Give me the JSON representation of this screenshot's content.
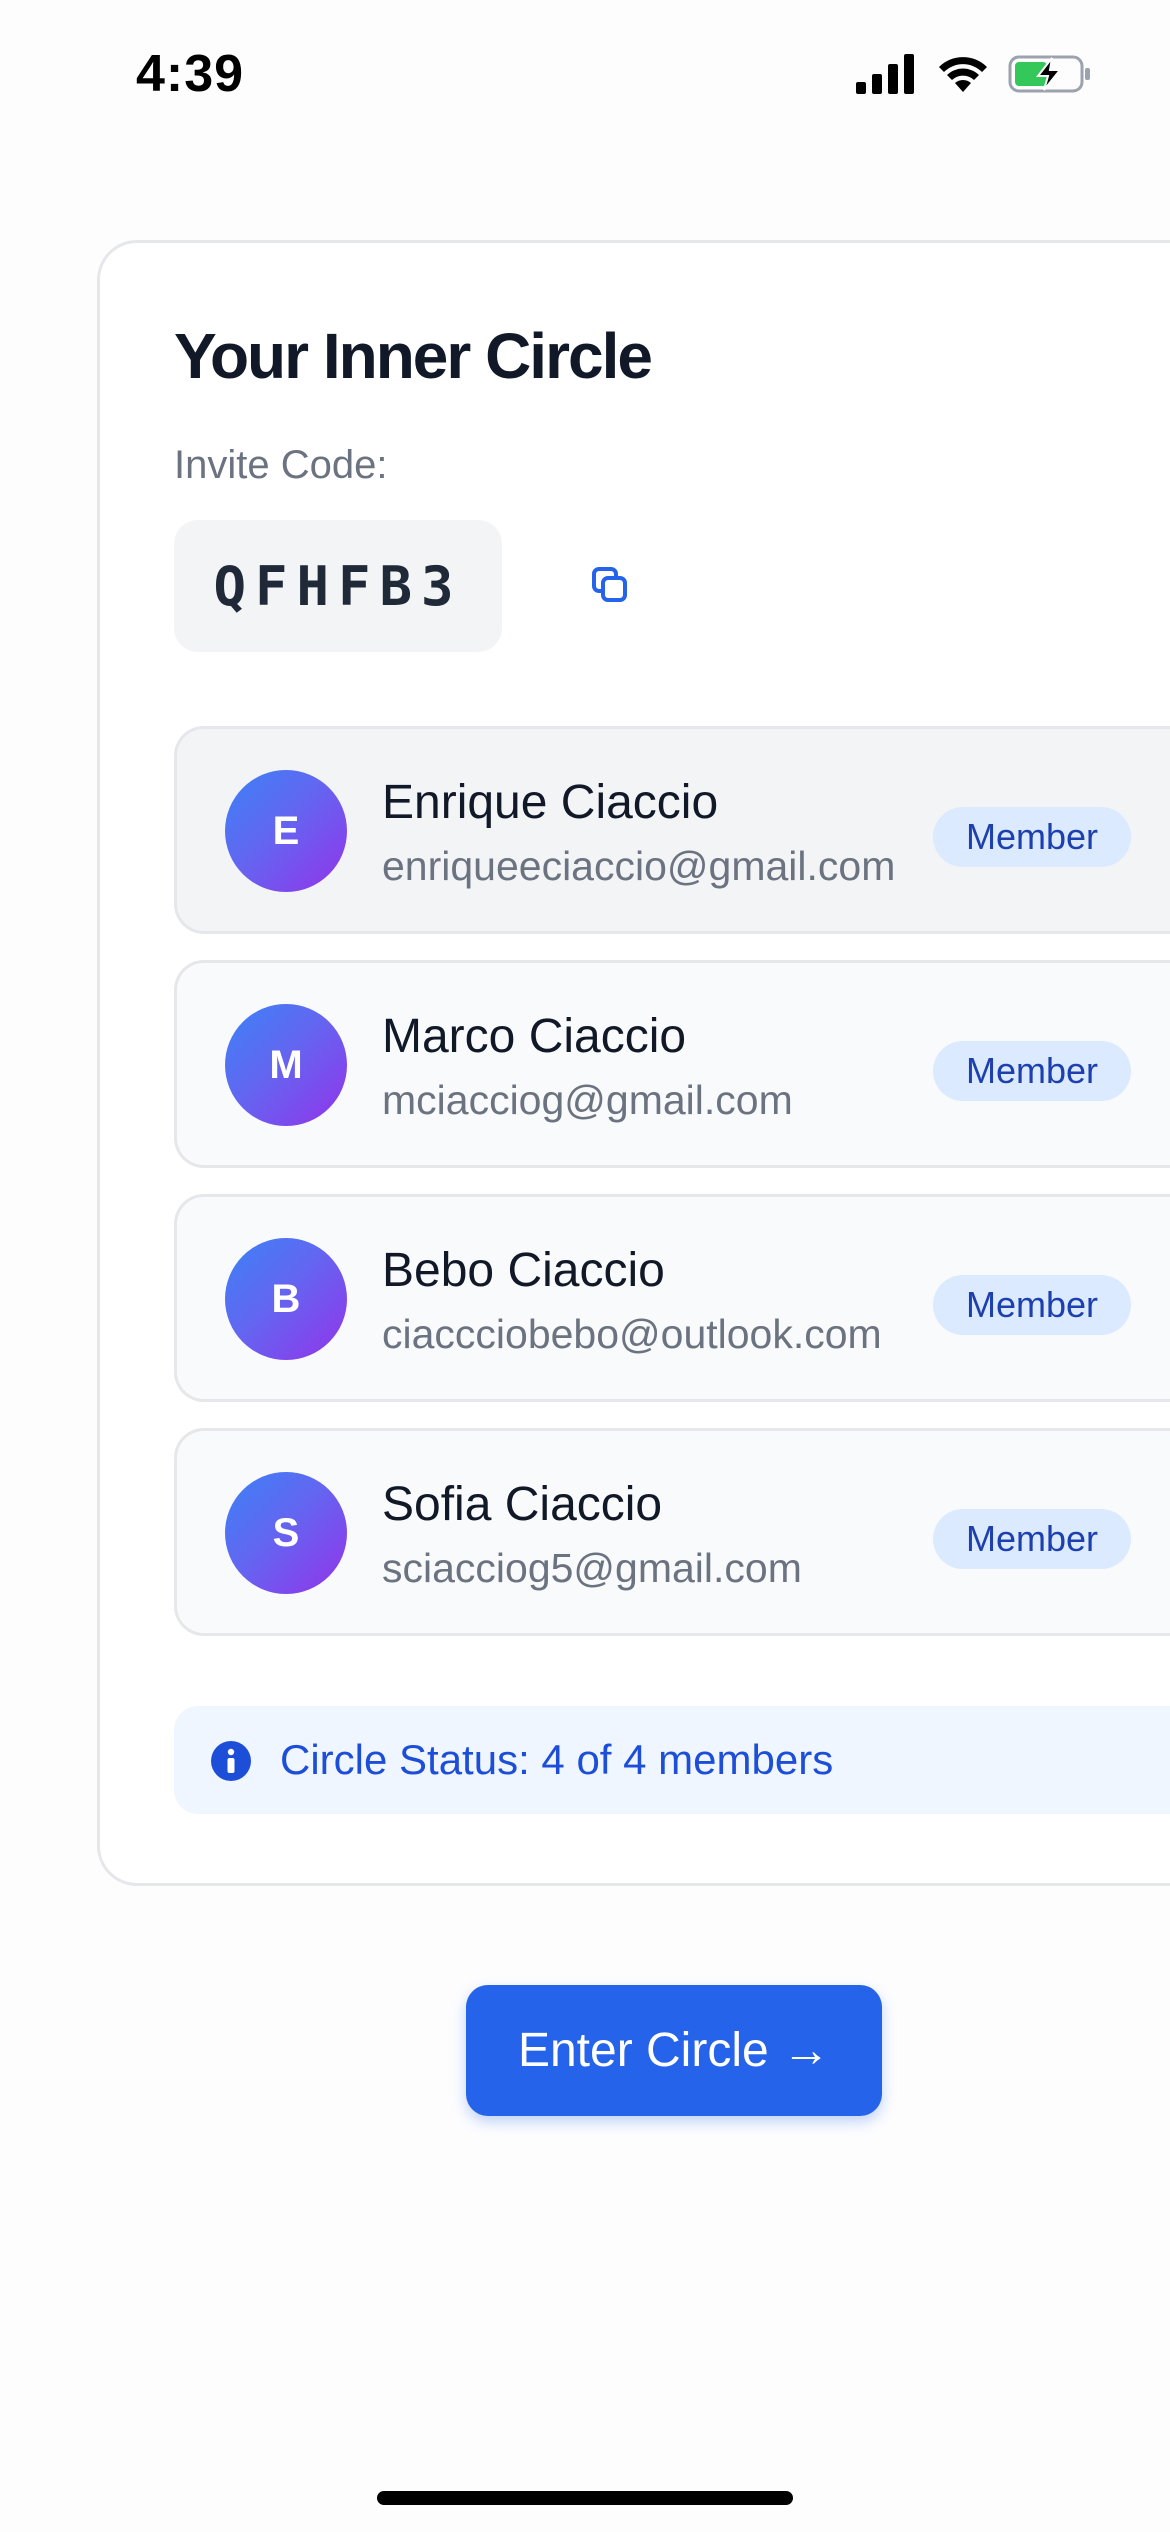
{
  "status_bar": {
    "time": "4:39",
    "icons": [
      "cellular-signal-icon",
      "wifi-icon",
      "battery-charging-icon"
    ],
    "battery_color": "#34c759"
  },
  "circle": {
    "title": "Your Inner Circle",
    "invite_label": "Invite Code:",
    "invite_code": "QFHFB3",
    "copy_icon": "copy-icon",
    "members": [
      {
        "initial": "E",
        "name": "Enrique Ciaccio",
        "email": "enriqueeciaccio@gmail.com",
        "role": "Member"
      },
      {
        "initial": "M",
        "name": "Marco Ciaccio",
        "email": "mciacciog@gmail.com",
        "role": "Member"
      },
      {
        "initial": "B",
        "name": "Bebo Ciaccio",
        "email": "ciaccciobebo@outlook.com",
        "role": "Member"
      },
      {
        "initial": "S",
        "name": "Sofia Ciaccio",
        "email": "sciacciog5@gmail.com",
        "role": "Member"
      }
    ],
    "status_icon": "info-icon",
    "status_text": "Circle Status: 4 of 4 members"
  },
  "actions": {
    "enter_label": "Enter Circle →"
  },
  "colors": {
    "accent": "#2563eb",
    "badge_bg": "#dbeafe",
    "badge_text": "#1e40af",
    "status_bg": "#eff6ff",
    "status_text": "#1d4ed8",
    "avatar_gradient": [
      "#3b82f6",
      "#9333ea"
    ]
  }
}
